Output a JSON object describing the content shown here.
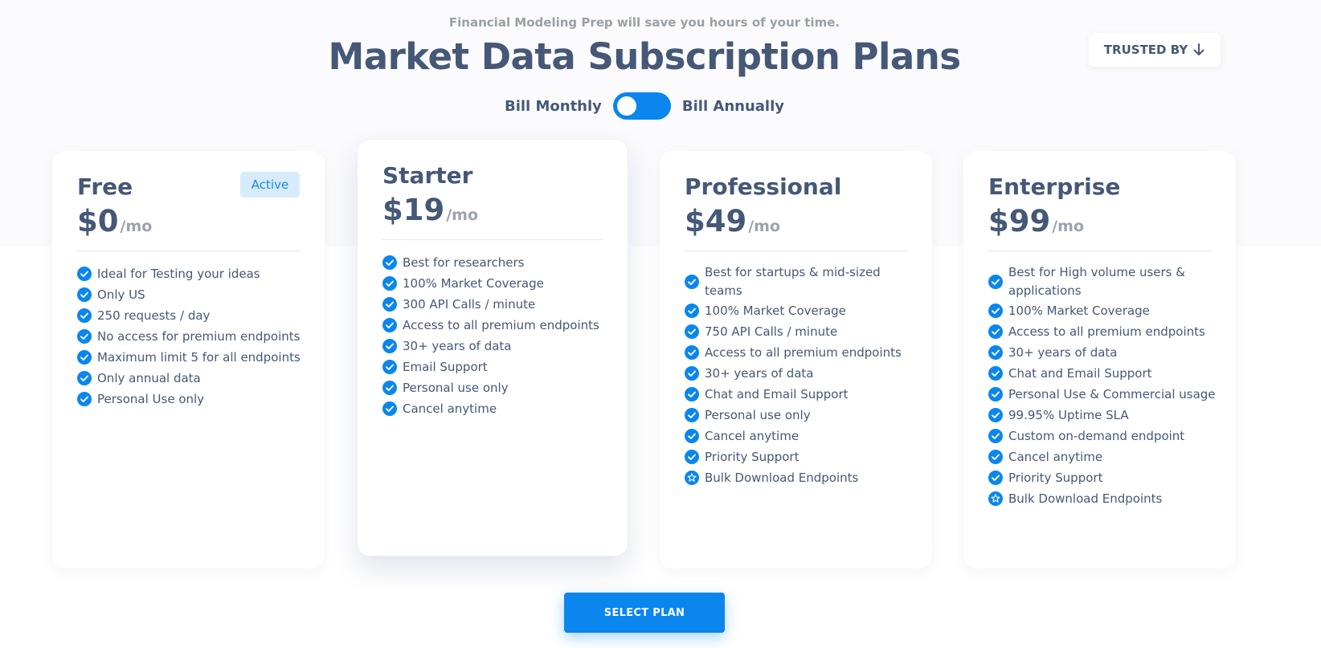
{
  "header": {
    "tagline": "Financial Modeling Prep will save you hours of your time.",
    "title": "Market Data Subscription Plans",
    "trusted_label": "TRUSTED BY",
    "trusted_icon": "arrow-down-icon"
  },
  "billing": {
    "monthly_label": "Bill Monthly",
    "annual_label": "Bill Annually",
    "toggle_state": "monthly"
  },
  "colors": {
    "accent": "#0a86ee",
    "text": "#465877",
    "muted": "#9ca3ae",
    "badge_bg": "#d7ecfb"
  },
  "plans": [
    {
      "name": "Free",
      "price": "$0",
      "per": "/mo",
      "badge": "Active",
      "features": [
        {
          "text": "Ideal for Testing your ideas",
          "icon": "check-circle-icon"
        },
        {
          "text": "Only US",
          "icon": "check-circle-icon"
        },
        {
          "text": "250 requests / day",
          "icon": "check-circle-icon"
        },
        {
          "text": "No access for premium endpoints",
          "icon": "check-circle-icon"
        },
        {
          "text": "Maximum limit 5 for all endpoints",
          "icon": "check-circle-icon"
        },
        {
          "text": "Only annual data",
          "icon": "check-circle-icon"
        },
        {
          "text": "Personal Use only",
          "icon": "check-circle-icon"
        }
      ]
    },
    {
      "name": "Starter",
      "price": "$19",
      "per": "/mo",
      "features": [
        {
          "text": "Best for researchers",
          "icon": "check-circle-icon"
        },
        {
          "text": "100% Market Coverage",
          "icon": "check-circle-icon"
        },
        {
          "text": "300 API Calls / minute",
          "icon": "check-circle-icon"
        },
        {
          "text": "Access to all premium endpoints",
          "icon": "check-circle-icon"
        },
        {
          "text": "30+ years of data",
          "icon": "check-circle-icon"
        },
        {
          "text": "Email Support",
          "icon": "check-circle-icon"
        },
        {
          "text": "Personal use only",
          "icon": "check-circle-icon"
        },
        {
          "text": "Cancel anytime",
          "icon": "check-circle-icon"
        }
      ]
    },
    {
      "name": "Professional",
      "price": "$49",
      "per": "/mo",
      "features": [
        {
          "text": "Best for startups & mid-sized teams",
          "icon": "check-circle-icon"
        },
        {
          "text": "100% Market Coverage",
          "icon": "check-circle-icon"
        },
        {
          "text": "750 API Calls / minute",
          "icon": "check-circle-icon"
        },
        {
          "text": "Access to all premium endpoints",
          "icon": "check-circle-icon"
        },
        {
          "text": "30+ years of data",
          "icon": "check-circle-icon"
        },
        {
          "text": "Chat and Email Support",
          "icon": "check-circle-icon"
        },
        {
          "text": "Personal use only",
          "icon": "check-circle-icon"
        },
        {
          "text": "Cancel anytime",
          "icon": "check-circle-icon"
        },
        {
          "text": "Priority Support",
          "icon": "check-circle-icon"
        },
        {
          "text": "Bulk Download Endpoints",
          "icon": "star-circle-icon"
        }
      ]
    },
    {
      "name": "Enterprise",
      "price": "$99",
      "per": "/mo",
      "features": [
        {
          "text": "Best for High volume users & applications",
          "icon": "check-circle-icon"
        },
        {
          "text": "100% Market Coverage",
          "icon": "check-circle-icon"
        },
        {
          "text": "Access to all premium endpoints",
          "icon": "check-circle-icon"
        },
        {
          "text": "30+ years of data",
          "icon": "check-circle-icon"
        },
        {
          "text": "Chat and Email Support",
          "icon": "check-circle-icon"
        },
        {
          "text": "Personal Use & Commercial usage",
          "icon": "check-circle-icon"
        },
        {
          "text": "99.95% Uptime SLA",
          "icon": "check-circle-icon"
        },
        {
          "text": "Custom on-demand endpoint",
          "icon": "check-circle-icon"
        },
        {
          "text": "Cancel anytime",
          "icon": "check-circle-icon"
        },
        {
          "text": "Priority Support",
          "icon": "check-circle-icon"
        },
        {
          "text": "Bulk Download Endpoints",
          "icon": "star-circle-icon"
        }
      ]
    }
  ],
  "cta": {
    "select_label": "SELECT PLAN"
  }
}
